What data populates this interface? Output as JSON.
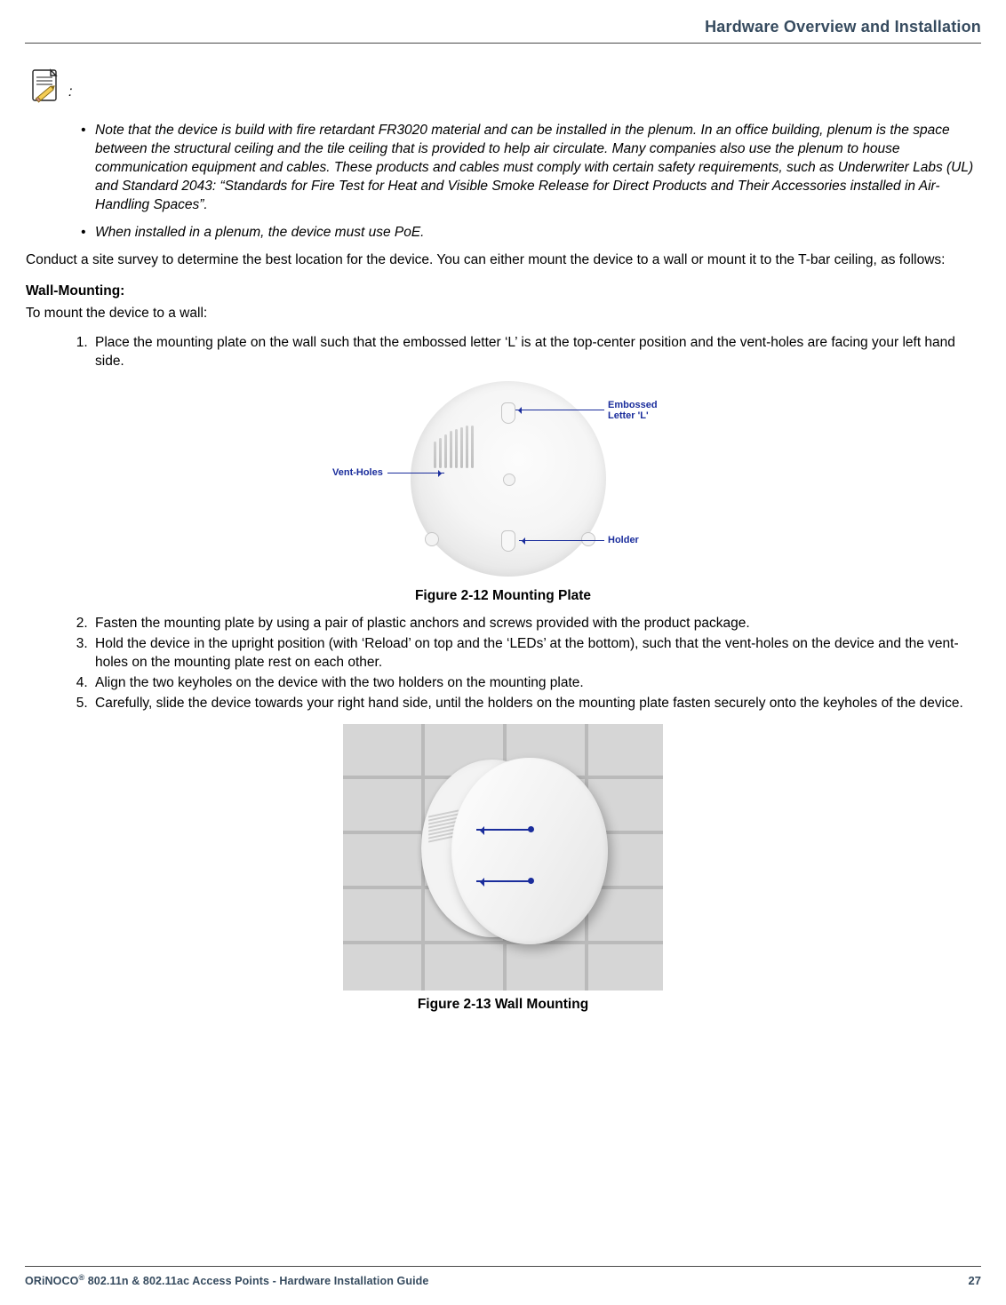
{
  "header": {
    "running_title": "Hardware Overview and Installation"
  },
  "note": {
    "marker": ":",
    "bullets": [
      "Note that the device is build with fire retardant FR3020 material and can be installed in the plenum. In an office building, plenum is the space between the structural ceiling and the tile ceiling that is provided to help air circulate. Many companies also use the plenum to house communication equipment and cables. These products and cables must comply with certain safety requirements, such as Underwriter Labs (UL) and Standard 2043: “Standards for Fire Test for Heat and Visible Smoke Release for Direct Products and Their Accessories installed in Air-Handling Spaces”.",
      "When installed in a plenum, the device must use PoE."
    ]
  },
  "intro_paragraph": "Conduct a site survey to determine the best location for the device. You can either mount the device to a wall or mount it to the T-bar ceiling, as follows:",
  "wall_mounting": {
    "heading": "Wall-Mounting:",
    "lead": "To mount the device to a wall:",
    "steps_part1": [
      "Place the mounting plate on the wall such that the embossed letter ‘L’ is at the top-center position and the vent-holes are facing your left hand side."
    ],
    "steps_part2": [
      "Fasten the mounting plate by using a pair of plastic anchors and screws provided with the product package.",
      "Hold the device in the upright position (with ‘Reload’ on top and the ‘LEDs’ at the bottom), such that the vent-holes on the device and the vent-holes on the mounting plate rest on each other.",
      "Align the two keyholes on the device with the two holders on the mounting plate.",
      "Carefully, slide the device towards your right hand side, until the holders on the mounting plate fasten securely onto the keyholes of the device."
    ]
  },
  "figures": {
    "fig1": {
      "caption": "Figure 2-12 Mounting Plate",
      "labels": {
        "vent": "Vent-Holes",
        "embossed_l_line1": "Embossed",
        "embossed_l_line2": "Letter 'L'",
        "holder": "Holder"
      }
    },
    "fig2": {
      "caption": "Figure 2-13 Wall Mounting"
    }
  },
  "footer": {
    "product_line_prefix": "ORiNOCO",
    "product_line_suffix": " 802.11n & 802.11ac Access Points - Hardware Installation Guide",
    "reg_mark": "®",
    "page_number": "27"
  }
}
